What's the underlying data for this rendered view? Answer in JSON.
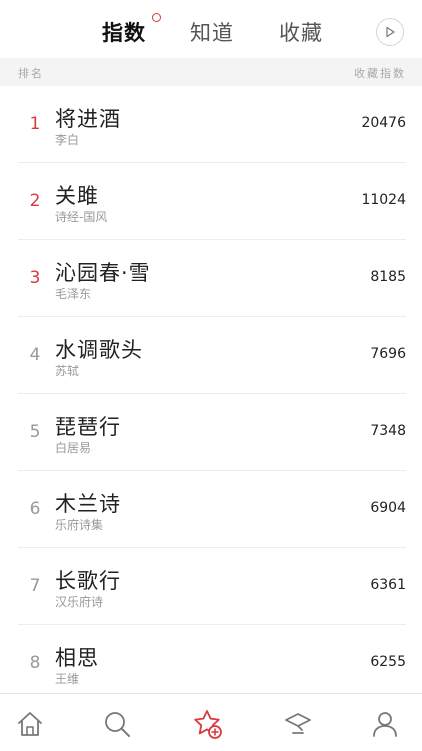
{
  "tabs": [
    {
      "label": "指数",
      "active": true
    },
    {
      "label": "知道",
      "active": false
    },
    {
      "label": "收藏",
      "active": false
    }
  ],
  "header": {
    "rank_label": "排名",
    "score_label": "收藏指数"
  },
  "rows": [
    {
      "rank": "1",
      "title": "将进酒",
      "author": "李白",
      "score": "20476"
    },
    {
      "rank": "2",
      "title": "关雎",
      "author": "诗经-国风",
      "score": "11024"
    },
    {
      "rank": "3",
      "title": "沁园春·雪",
      "author": "毛泽东",
      "score": "8185"
    },
    {
      "rank": "4",
      "title": "水调歌头",
      "author": "苏轼",
      "score": "7696"
    },
    {
      "rank": "5",
      "title": "琵琶行",
      "author": "白居易",
      "score": "7348"
    },
    {
      "rank": "6",
      "title": "木兰诗",
      "author": "乐府诗集",
      "score": "6904"
    },
    {
      "rank": "7",
      "title": "长歌行",
      "author": "汉乐府诗",
      "score": "6361"
    },
    {
      "rank": "8",
      "title": "相思",
      "author": "王维",
      "score": "6255"
    }
  ],
  "icons": {
    "play": "play-icon",
    "home": "home-icon",
    "search": "search-icon",
    "favorites": "star-plus-icon",
    "learn": "hat-icon",
    "user": "user-icon"
  },
  "colors": {
    "accent": "#d9393f",
    "text": "#222222",
    "muted": "#999999",
    "header_bg": "#f4f4f4",
    "divider": "#ececec"
  }
}
